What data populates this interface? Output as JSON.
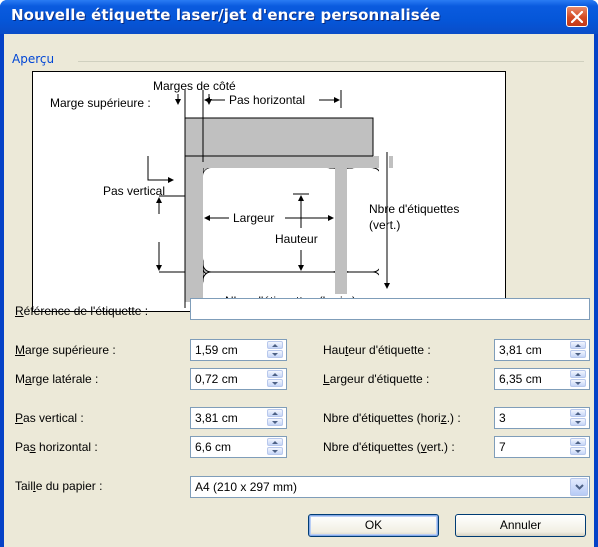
{
  "window": {
    "title": "Nouvelle étiquette laser/jet d'encre personnalisée"
  },
  "preview": {
    "group_label": "Aperçu",
    "labels": {
      "marges_cote": "Marges de côté",
      "marge_sup": "Marge supérieure :",
      "pas_horiz": "Pas horizontal",
      "pas_vert": "Pas vertical",
      "largeur": "Largeur",
      "hauteur": "Hauteur",
      "nbre_vert_1": "Nbre d'étiquettes",
      "nbre_vert_2": "(vert.)",
      "nbre_horiz": "Nbre d'étiquettes (horiz.)"
    }
  },
  "form": {
    "ref_label_u": "R",
    "ref_label_rest": "éférence de l'étiquette :",
    "ref_value": "",
    "marge_sup_u": "M",
    "marge_sup_rest": "arge supérieure :",
    "marge_sup_value": "1,59 cm",
    "marge_lat_pre": "M",
    "marge_lat_u": "a",
    "marge_lat_rest": "rge latérale :",
    "marge_lat_value": "0,72 cm",
    "pas_vert_u": "P",
    "pas_vert_rest": "as vertical :",
    "pas_vert_value": "3,81 cm",
    "pas_horiz_pre": "Pa",
    "pas_horiz_u": "s",
    "pas_horiz_rest": " horizontal :",
    "pas_horiz_value": "6,6 cm",
    "hauteur_pre": "Hau",
    "hauteur_u": "t",
    "hauteur_rest": "eur d'étiquette :",
    "hauteur_value": "3,81 cm",
    "largeur_u": "L",
    "largeur_rest": "argeur d'étiquette :",
    "largeur_value": "6,35 cm",
    "nbre_h_pre": "Nbre d'étiquettes (hori",
    "nbre_h_u": "z",
    "nbre_h_rest": ".) :",
    "nbre_h_value": "3",
    "nbre_v_pre": "Nbre d'étiquettes (",
    "nbre_v_u": "v",
    "nbre_v_rest": "ert.) :",
    "nbre_v_value": "7",
    "taille_pre": "Tail",
    "taille_u": "l",
    "taille_rest": "e du papier :",
    "taille_value": "A4 (210 x 297 mm)"
  },
  "buttons": {
    "ok": "OK",
    "cancel": "Annuler"
  },
  "colors": {
    "title_bar": "#0556d8",
    "group_label": "#0046d5",
    "dialog_bg": "#ece9d8",
    "close_button": "#d44a22"
  },
  "icons": {
    "close": "close-icon",
    "spin_up": "chevron-up-icon",
    "spin_down": "chevron-down-icon",
    "dropdown": "chevron-down-icon"
  }
}
